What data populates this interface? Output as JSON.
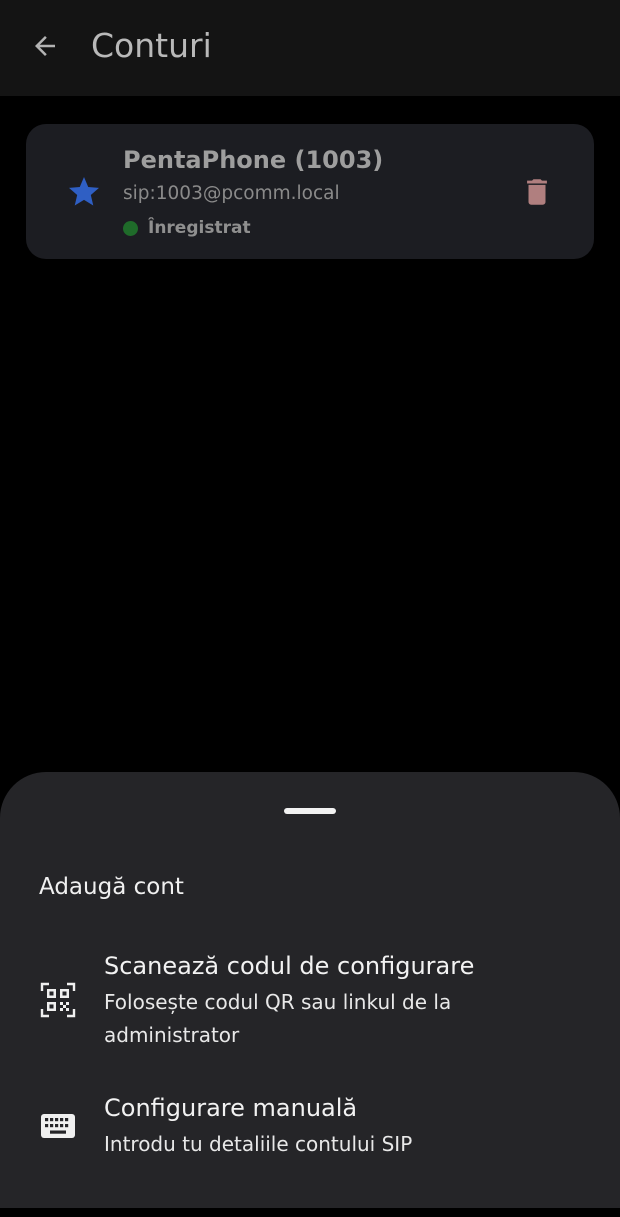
{
  "app_bar": {
    "title": "Conturi",
    "back_icon": "arrow-left-icon"
  },
  "account": {
    "name": "PentaPhone (1003)",
    "uri": "sip:1003@pcomm.local",
    "status": "Înregistrat",
    "default_icon": "star-icon",
    "delete_icon": "trash-icon",
    "status_color": "#1f6b2a",
    "star_color": "#2f5fc4",
    "trash_color": "#b07f7f"
  },
  "sheet": {
    "title": "Adaugă cont",
    "options": [
      {
        "icon": "qr-code-scan-icon",
        "title": "Scanează codul de configurare",
        "subtitle": "Folosește codul QR sau linkul de la administrator"
      },
      {
        "icon": "keyboard-icon",
        "title": "Configurare manuală",
        "subtitle": "Introdu tu detaliile contului SIP"
      }
    ]
  }
}
